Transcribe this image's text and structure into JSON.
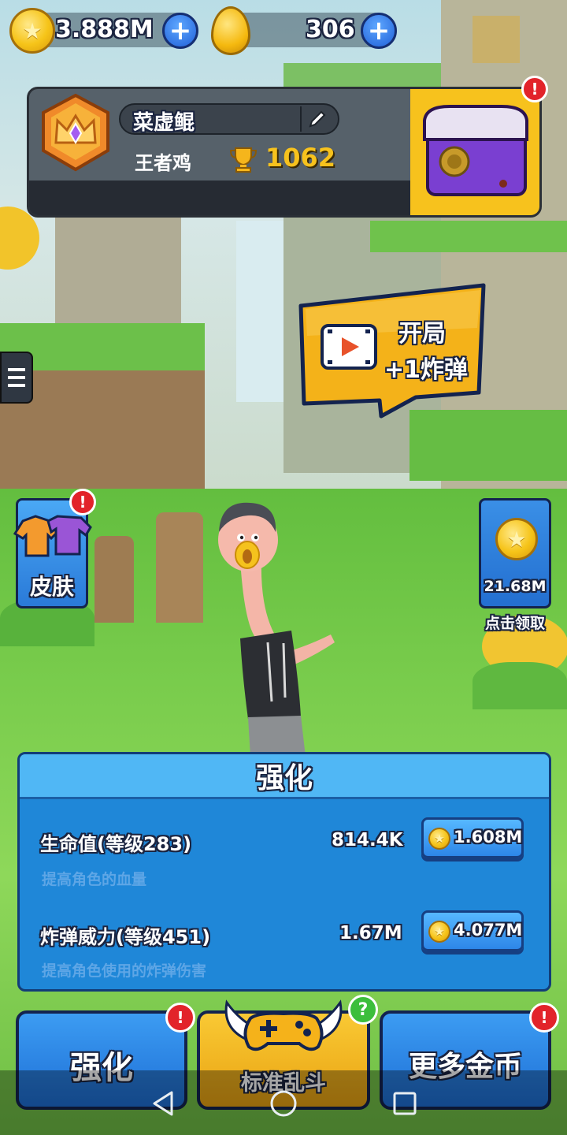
{
  "currency": {
    "coins": "3.888M",
    "gold_eggs": "306",
    "plus": "+"
  },
  "profile": {
    "name": "菜虚鲲",
    "rank_title": "王者鸡",
    "trophies": "1062",
    "chest_alert": "!"
  },
  "menu_icon": "hamburger-menu-icon",
  "promo": {
    "line1": "开局",
    "line2": "+1炸弹"
  },
  "skins": {
    "label": "皮肤",
    "alert": "!"
  },
  "coin_reward": {
    "amount": "21.68M",
    "action": "点击领取"
  },
  "upgrade_panel": {
    "title": "强化",
    "rows": [
      {
        "name": "生命值(等级283)",
        "value": "814.4K",
        "cost": "1.608M",
        "desc": "提高角色的血量"
      },
      {
        "name": "炸弹威力(等级451)",
        "value": "1.67M",
        "cost": "4.077M",
        "desc": "提高角色使用的炸弹伤害"
      }
    ]
  },
  "bottom_bar": {
    "upgrade_label": "强化",
    "upgrade_alert": "!",
    "mode_label": "标准乱斗",
    "mode_help": "?",
    "coins_label": "更多金币",
    "coins_alert": "!"
  },
  "colors": {
    "accent_yellow": "#f7c21d",
    "panel_blue": "#1f87d8",
    "header_blue": "#50b7f5",
    "alert_red": "#e2232a",
    "dark_outline": "#13234f"
  }
}
